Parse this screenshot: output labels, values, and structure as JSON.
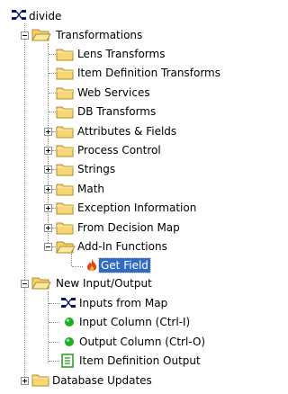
{
  "tree": {
    "root": {
      "label": "divide",
      "icon": "mapping-icon"
    },
    "transformations": {
      "label": "Transformations",
      "children": [
        {
          "label": "Lens Transforms",
          "expandable": false
        },
        {
          "label": "Item Definition Transforms",
          "expandable": false
        },
        {
          "label": "Web Services",
          "expandable": false
        },
        {
          "label": "DB Transforms",
          "expandable": false
        },
        {
          "label": "Attributes & Fields",
          "expandable": true
        },
        {
          "label": "Process Control",
          "expandable": true
        },
        {
          "label": "Strings",
          "expandable": true
        },
        {
          "label": "Math",
          "expandable": true
        },
        {
          "label": "Exception Information",
          "expandable": true
        },
        {
          "label": "From Decision Map",
          "expandable": true
        },
        {
          "label": "Add-In Functions",
          "expandable": true,
          "expanded": true
        }
      ],
      "addin_children": [
        {
          "label": "Get Field",
          "icon": "flame-icon",
          "selected": true
        }
      ]
    },
    "new_io": {
      "label": "New Input/Output",
      "children": [
        {
          "label": "Inputs from Map",
          "icon": "mapping-icon"
        },
        {
          "label": "Input Column (Ctrl-I)",
          "icon": "green-dot-icon"
        },
        {
          "label": "Output Column (Ctrl-O)",
          "icon": "green-dot-icon"
        },
        {
          "label": "Item Definition Output",
          "icon": "item-definition-icon"
        }
      ]
    },
    "database_updates": {
      "label": "Database Updates"
    }
  },
  "colors": {
    "selection": "#316ac5",
    "folder": "#f7d774",
    "green": "#1fae1f",
    "flame": "#e2451b"
  }
}
